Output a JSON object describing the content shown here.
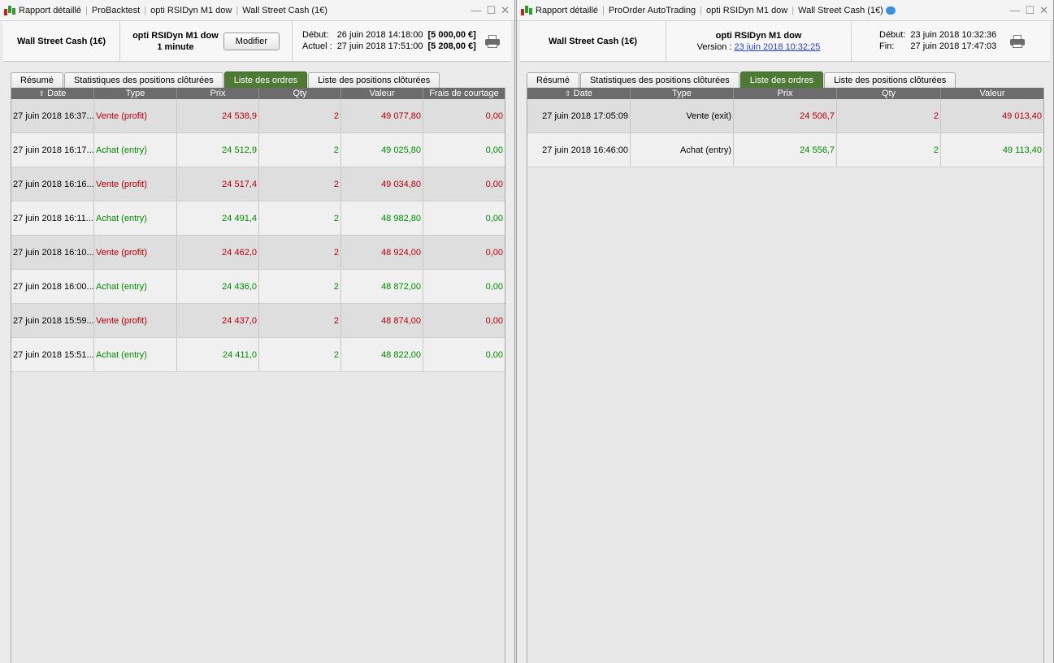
{
  "left": {
    "title_parts": [
      "Rapport détaillé",
      "ProBacktest",
      "opti RSIDyn M1 dow",
      "Wall Street Cash (1€)"
    ],
    "instrument": "Wall Street Cash (1€)",
    "strategy": "opti RSIDyn M1 dow",
    "timeframe": "1 minute",
    "modify_label": "Modifier",
    "debut_label": "Début:",
    "debut_value": "26 juin 2018 14:18:00",
    "debut_amount": "[5 000,00 €]",
    "actuel_label": "Actuel :",
    "actuel_value": "27 juin 2018 17:51:00",
    "actuel_amount": "[5 208,00 €]",
    "tabs": [
      "Résumé",
      "Statistiques des positions clôturées",
      "Liste des ordres",
      "Liste des positions clôturées"
    ],
    "columns": [
      "Date",
      "Type",
      "Prix",
      "Qty",
      "Valeur",
      "Frais de courtage"
    ],
    "rows": [
      {
        "date": "27 juin 2018 16:37...",
        "type": "Vente (profit)",
        "prix": "24 538,9",
        "qty": "2",
        "valeur": "49 077,80",
        "frais": "0,00",
        "side": "sell"
      },
      {
        "date": "27 juin 2018 16:17...",
        "type": "Achat (entry)",
        "prix": "24 512,9",
        "qty": "2",
        "valeur": "49 025,80",
        "frais": "0,00",
        "side": "buy"
      },
      {
        "date": "27 juin 2018 16:16...",
        "type": "Vente (profit)",
        "prix": "24 517,4",
        "qty": "2",
        "valeur": "49 034,80",
        "frais": "0,00",
        "side": "sell"
      },
      {
        "date": "27 juin 2018 16:11...",
        "type": "Achat (entry)",
        "prix": "24 491,4",
        "qty": "2",
        "valeur": "48 982,80",
        "frais": "0,00",
        "side": "buy"
      },
      {
        "date": "27 juin 2018 16:10...",
        "type": "Vente (profit)",
        "prix": "24 462,0",
        "qty": "2",
        "valeur": "48 924,00",
        "frais": "0,00",
        "side": "sell"
      },
      {
        "date": "27 juin 2018 16:00...",
        "type": "Achat (entry)",
        "prix": "24 436,0",
        "qty": "2",
        "valeur": "48 872,00",
        "frais": "0,00",
        "side": "buy"
      },
      {
        "date": "27 juin 2018 15:59...",
        "type": "Vente (profit)",
        "prix": "24 437,0",
        "qty": "2",
        "valeur": "48 874,00",
        "frais": "0,00",
        "side": "sell"
      },
      {
        "date": "27 juin 2018 15:51...",
        "type": "Achat (entry)",
        "prix": "24 411,0",
        "qty": "2",
        "valeur": "48 822,00",
        "frais": "0,00",
        "side": "buy"
      }
    ]
  },
  "right": {
    "title_parts": [
      "Rapport détaillé",
      "ProOrder AutoTrading",
      "opti RSIDyn M1 dow",
      "Wall Street Cash (1€)"
    ],
    "instrument": "Wall Street Cash (1€)",
    "strategy": "opti RSIDyn M1 dow",
    "version_label": "Version :",
    "version_value": "23 juin 2018 10:32:25",
    "debut_label": "Début:",
    "debut_value": "23 juin 2018 10:32:36",
    "fin_label": "Fin:",
    "fin_value": "27 juin 2018 17:47:03",
    "tabs": [
      "Résumé",
      "Statistiques des positions clôturées",
      "Liste des ordres",
      "Liste des positions clôturées"
    ],
    "columns": [
      "Date",
      "Type",
      "Prix",
      "Qty",
      "Valeur"
    ],
    "rows": [
      {
        "date": "27 juin 2018 17:05:09",
        "type": "Vente (exit)",
        "prix": "24 506,7",
        "qty": "2",
        "valeur": "49 013,40",
        "side": "sell"
      },
      {
        "date": "27 juin 2018 16:46:00",
        "type": "Achat (entry)",
        "prix": "24 556,7",
        "qty": "2",
        "valeur": "49 113,40",
        "side": "buy"
      }
    ]
  },
  "colors": {
    "sell": "#b2000a",
    "buy": "#008a00",
    "active_tab": "#4e7a36",
    "header_bg": "#6c6c6c"
  }
}
